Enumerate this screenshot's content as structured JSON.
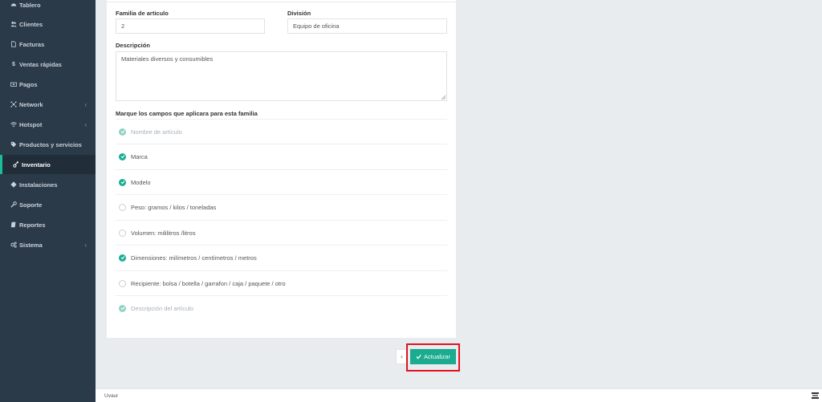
{
  "sidebar": {
    "items": [
      {
        "label": "Tablero",
        "icon": "dashboard-icon"
      },
      {
        "label": "Clientes",
        "icon": "users-icon"
      },
      {
        "label": "Facturas",
        "icon": "file-icon"
      },
      {
        "label": "Ventas rápidas",
        "icon": "dollar-icon"
      },
      {
        "label": "Pagos",
        "icon": "money-icon"
      },
      {
        "label": "Network",
        "icon": "network-icon",
        "chevron": "‹"
      },
      {
        "label": "Hotspot",
        "icon": "wifi-icon",
        "chevron": "‹"
      },
      {
        "label": "Productos y servicios",
        "icon": "tag-icon"
      },
      {
        "label": "Inventario",
        "icon": "inventory-icon",
        "active": true
      },
      {
        "label": "Instalaciones",
        "icon": "tools-icon"
      },
      {
        "label": "Soporte",
        "icon": "wrench-icon"
      },
      {
        "label": "Reportes",
        "icon": "book-icon"
      },
      {
        "label": "Sistema",
        "icon": "cogs-icon",
        "chevron": "‹"
      }
    ]
  },
  "form": {
    "familia_label": "Familia de articulo",
    "familia_value": "2",
    "division_label": "División",
    "division_value": "Equipo de oficina",
    "descripcion_label": "Descripción",
    "descripcion_value": "Materiales diversos y consumibles",
    "campos_label": "Marque los campos que aplicara para esta familia"
  },
  "fields": [
    {
      "label": "Nombre de artículo",
      "state": "disabled-checked"
    },
    {
      "label": "Marca",
      "state": "checked"
    },
    {
      "label": "Modelo",
      "state": "checked"
    },
    {
      "label": "Peso: gramos / kilos / toneladas",
      "state": "unchecked"
    },
    {
      "label": "Volumen: mililitros /litros",
      "state": "unchecked"
    },
    {
      "label": "Dimensiones: milímetros / centímetros / metros",
      "state": "checked"
    },
    {
      "label": "Recipiente: bolsa / botella / garrafon / caja / paquete / otro",
      "state": "unchecked"
    },
    {
      "label": "Descripción del artículo",
      "state": "disabled-checked"
    }
  ],
  "actions": {
    "prev_label": "‹",
    "update_label": "Actualizar"
  },
  "footer": {
    "text": "Uvaur"
  },
  "colors": {
    "sidebar_bg": "#2b3a48",
    "accent": "#1bab8e",
    "highlight": "#e0141e"
  }
}
